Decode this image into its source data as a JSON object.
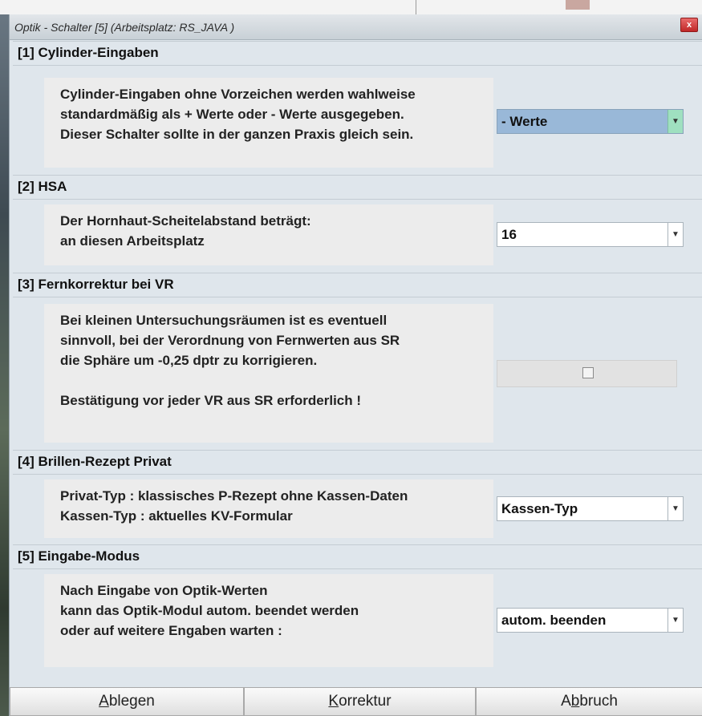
{
  "window": {
    "title": "Optik - Schalter [5]  (Arbeitsplatz: RS_JAVA )",
    "close_label": "x"
  },
  "sections": [
    {
      "header": "[1] Cylinder-Eingaben",
      "lines": [
        "Cylinder-Eingaben ohne Vorzeichen werden wahlweise",
        "standardmäßig als + Werte oder - Werte ausgegeben.",
        "Dieser Schalter sollte in der ganzen Praxis gleich sein."
      ],
      "control_value": "- Werte"
    },
    {
      "header": "[2] HSA",
      "lines": [
        "Der Hornhaut-Scheitelabstand beträgt:",
        "an diesen Arbeitsplatz"
      ],
      "control_value": "16"
    },
    {
      "header": "[3] Fernkorrektur bei VR",
      "lines": [
        "Bei kleinen Untersuchungsräumen ist es eventuell",
        "sinnvoll, bei der Verordnung von Fernwerten aus SR",
        "die Sphäre um -0,25 dptr zu korrigieren.",
        "",
        "Bestätigung vor jeder VR aus SR erforderlich !"
      ],
      "checked": false
    },
    {
      "header": "[4] Brillen-Rezept Privat",
      "lines": [
        "Privat-Typ : klassisches P-Rezept ohne Kassen-Daten",
        "Kassen-Typ : aktuelles KV-Formular"
      ],
      "control_value": "Kassen-Typ"
    },
    {
      "header": "[5] Eingabe-Modus",
      "lines": [
        "Nach Eingabe von Optik-Werten",
        "kann das Optik-Modul autom. beendet werden",
        "oder auf weitere Engaben warten :"
      ],
      "control_value": "autom. beenden"
    }
  ],
  "buttons": {
    "ablegen": {
      "mnemonic": "A",
      "rest": "blegen"
    },
    "korrektur": {
      "mnemonic": "K",
      "rest": "orrektur"
    },
    "abbruch": {
      "pre": "A",
      "mnemonic": "b",
      "rest": "bruch"
    }
  },
  "colors": {
    "dropdown_selected_bg": "#99b8d8",
    "dropdown_arrow_accent": "#9fe0c0",
    "close_button": "#c02828"
  }
}
